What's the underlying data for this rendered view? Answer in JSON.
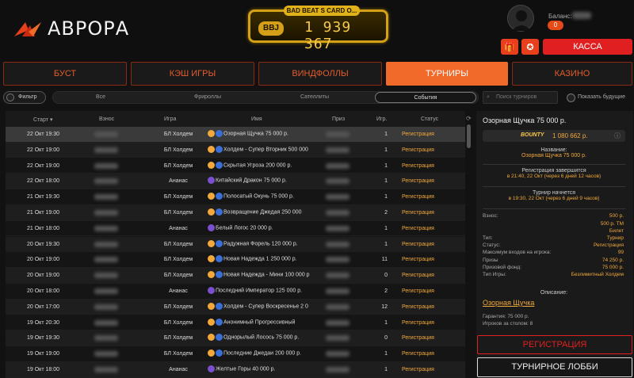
{
  "brand": {
    "name": "АВРОРА"
  },
  "jackpot": {
    "badge": "BAD BEAT S CARD O...",
    "label": "ВВJ",
    "value": "1 939 367"
  },
  "account": {
    "balance_label": "Баланс:",
    "balance_pill": "0",
    "cash_label": "КАССА"
  },
  "nav_tabs": [
    {
      "label": "БУСТ"
    },
    {
      "label": "КЭШ ИГРЫ"
    },
    {
      "label": "ВИНДФОЛЛЫ"
    },
    {
      "label": "ТУРНИРЫ"
    },
    {
      "label": "КАЗИНО"
    }
  ],
  "filters": {
    "filter_label": "Фильтр",
    "segments": [
      "Все",
      "Фрироллы",
      "Сателлиты",
      "События"
    ],
    "active_segment": "События",
    "search_placeholder": "Поиск турниров",
    "show_future_label": "Показать будущие"
  },
  "table": {
    "headers": [
      "Старт ▾",
      "Взнос",
      "Игра",
      "Имя",
      "Приз",
      "Игр.",
      "Статус"
    ],
    "rows": [
      {
        "start": "22 Окт 19:30",
        "game": "БЛ Холдем",
        "name": "Озорная Щучка 75 000 р.",
        "players": "1",
        "status": "Регистрация"
      },
      {
        "start": "22 Окт 19:00",
        "game": "БЛ Холдем",
        "name": "Холдем - Супер Вторник 500 000",
        "players": "1",
        "status": "Регистрация"
      },
      {
        "start": "22 Окт 19:00",
        "game": "БЛ Холдем",
        "name": "Скрытая Угроза 200 000 р.",
        "players": "1",
        "status": "Регистрация"
      },
      {
        "start": "22 Окт 18:00",
        "game": "Ананас",
        "name": "Китайский Дракон 75 000 р.",
        "players": "1",
        "status": "Регистрация"
      },
      {
        "start": "21 Окт 19:30",
        "game": "БЛ Холдем",
        "name": "Полосатый Окунь 75 000 р.",
        "players": "1",
        "status": "Регистрация"
      },
      {
        "start": "21 Окт 19:00",
        "game": "БЛ Холдем",
        "name": "Возвращение Джедая 250 000",
        "players": "2",
        "status": "Регистрация"
      },
      {
        "start": "21 Окт 18:00",
        "game": "Ананас",
        "name": "Белый Логос 20 000 р.",
        "players": "1",
        "status": "Регистрация"
      },
      {
        "start": "20 Окт 19:30",
        "game": "БЛ Холдем",
        "name": "Радужная Форель 120 000 р.",
        "players": "1",
        "status": "Регистрация"
      },
      {
        "start": "20 Окт 19:00",
        "game": "БЛ Холдем",
        "name": "Новая Надежда 1 250 000 р.",
        "players": "11",
        "status": "Регистрация"
      },
      {
        "start": "20 Окт 19:00",
        "game": "БЛ Холдем",
        "name": "Новая Надежда - Мини 100 000 р",
        "players": "0",
        "status": "Регистрация"
      },
      {
        "start": "20 Окт 18:00",
        "game": "Ананас",
        "name": "Последний Император 125 000 р.",
        "players": "2",
        "status": "Регистрация"
      },
      {
        "start": "20 Окт 17:00",
        "game": "БЛ Холдем",
        "name": "Холдем - Супер Воскресенье 2 0",
        "players": "12",
        "status": "Регистрация"
      },
      {
        "start": "19 Окт 20:30",
        "game": "БЛ Холдем",
        "name": "Анонимный Прогрессивный",
        "players": "1",
        "status": "Регистрация"
      },
      {
        "start": "19 Окт 19:30",
        "game": "БЛ Холдем",
        "name": "Однорылый Лосось 75 000 р.",
        "players": "0",
        "status": "Регистрация"
      },
      {
        "start": "19 Окт 19:00",
        "game": "БЛ Холдем",
        "name": "Последние Джедаи 200 000 р.",
        "players": "1",
        "status": "Регистрация"
      },
      {
        "start": "19 Окт 18:00",
        "game": "Ананас",
        "name": "Желтые Горы 40 000 р.",
        "players": "1",
        "status": "Регистрация"
      }
    ]
  },
  "details": {
    "title": "Озорная Щучка 75 000 р.",
    "bounty_label": "BOUNTY",
    "bounty_value": "1 080 662 р.",
    "name_label": "Название:",
    "name_value": "Озорная Щучка 75 000 р.",
    "reg_end_label": "Регистрация завершится",
    "reg_end_value": "в 21:40, 22 Окт (через 6 дней 12 часов)",
    "start_label": "Турнир начнется",
    "start_value": "в 19:30, 22 Окт (через 6 дней 9 часов)",
    "buyin_label": "Взнос:",
    "buyin_values": [
      "500 р.",
      "500 р. TM",
      "Билет"
    ],
    "kv": [
      {
        "k": "Тип:",
        "v": "Турнир"
      },
      {
        "k": "Статус:",
        "v": "Регистрация"
      },
      {
        "k": "Максимум входов на игрока:",
        "v": "99"
      },
      {
        "k": "Призы",
        "v": "74 250 р."
      },
      {
        "k": "Призовой фонд:",
        "v": "75 000 р."
      },
      {
        "k": "Тип Игры:",
        "v": "Безлимитный Холдем"
      }
    ],
    "desc_label": "Описание:",
    "desc_link": "Озорная Щучка",
    "guarantee_label": "Гарантия:",
    "guarantee_value": "75 000 р.",
    "players_table_label": "Игроков за столом:",
    "players_table_value": "8"
  },
  "actions": {
    "register_label": "РЕГИСТРАЦИЯ",
    "lobby_label": "ТУРНИРНОЕ ЛОББИ"
  },
  "colors": {
    "accent": "#f26a2a",
    "status": "#f2a83a",
    "danger": "#e02020",
    "gold": "#d4a017"
  }
}
